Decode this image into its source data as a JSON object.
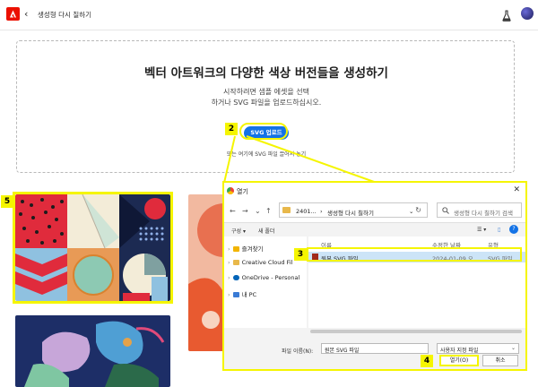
{
  "header": {
    "back_symbol": "‹",
    "page_title": "생성형 다시 칠하기"
  },
  "upload": {
    "heading": "벡터 아트워크의 다양한 색상 버전들을 생성하기",
    "subtext_line1": "시작하려면 샘플 에셋을 선택",
    "subtext_line2": "하거나 SVG 파일을 업로드하십시오.",
    "button_label": "SVG 업로드",
    "drop_text": "또는 여기에 SVG 파일 끌어서 놓기"
  },
  "callouts": {
    "c2": "2",
    "c3": "3",
    "c4": "4",
    "c5": "5"
  },
  "dialog": {
    "title": "열기",
    "close_symbol": "✕",
    "nav": {
      "back": "←",
      "forward": "→",
      "down": "⌄",
      "up": "↑"
    },
    "address": {
      "part1": "2401...",
      "sep1": "›",
      "part2": "생성형 다시 칠하기",
      "chevron": "⌄",
      "refresh": "↻"
    },
    "search_placeholder": "생성형 다시 칠하기 검색",
    "toolbar": {
      "organize": "구성 ▾",
      "new_folder": "새 폴더",
      "view": "☰ ▾",
      "pane": "▯",
      "help": "?"
    },
    "nav_pane": [
      {
        "label": "즐겨찾기",
        "icon_color": "#f2b400",
        "expander": "›"
      },
      {
        "label": "Creative Cloud Fil",
        "icon_color": "#e8b84a",
        "expander": "›"
      },
      {
        "label": "OneDrive - Personal",
        "icon_color": "#0364b8",
        "expander": "›"
      },
      {
        "label": "내 PC",
        "icon_color": "#3a7bd5",
        "expander": "›"
      }
    ],
    "columns": {
      "name": "이름",
      "modified": "수정한 날짜",
      "type": "유형"
    },
    "files": [
      {
        "name": "원본 SVG 파일",
        "modified": "2024-01-09 오...",
        "type": "SVG 파일"
      }
    ],
    "filename_label": "파일 이름(N):",
    "filename_value": "원본 SVG 파일",
    "filetype_value": "사용자 지정 파일",
    "filetype_chevron": "⌄",
    "open_label": "열기(O)",
    "cancel_label": "취소"
  },
  "colors": {
    "accent": "#1473e6",
    "callout": "#f5f500",
    "adobe_red": "#eb1000"
  }
}
